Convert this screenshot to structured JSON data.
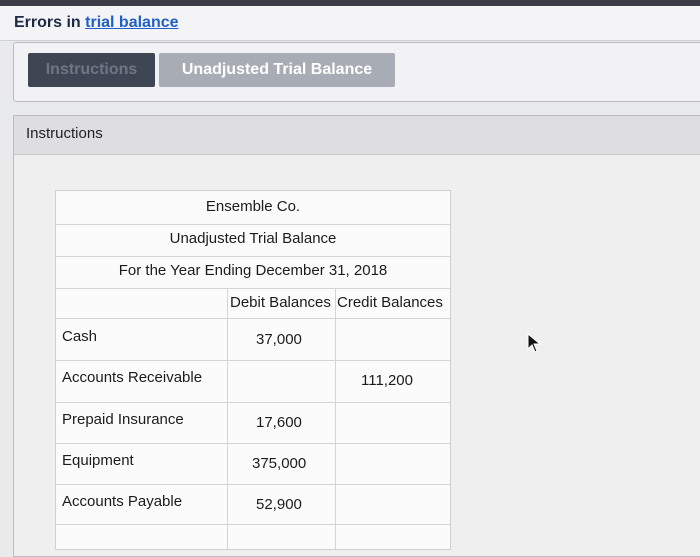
{
  "page": {
    "title_prefix": "Errors in ",
    "title_link": "trial balance"
  },
  "tabs": [
    {
      "label": "Instructions"
    },
    {
      "label": "Unadjusted Trial Balance"
    }
  ],
  "content": {
    "header_label": "Instructions"
  },
  "trial_balance": {
    "company": "Ensemble Co.",
    "report_title": "Unadjusted Trial Balance",
    "period": "For the Year Ending December 31, 2018",
    "col_debit": "Debit Balances",
    "col_credit": "Credit Balances",
    "rows": [
      {
        "account": "Cash",
        "debit": "37,000",
        "credit": ""
      },
      {
        "account": "Accounts Receivable",
        "debit": "",
        "credit": "111,200"
      },
      {
        "account": "Prepaid Insurance",
        "debit": "17,600",
        "credit": ""
      },
      {
        "account": "Equipment",
        "debit": "375,000",
        "credit": ""
      },
      {
        "account": "Accounts Payable",
        "debit": "52,900",
        "credit": ""
      }
    ]
  },
  "icons": {
    "cursor": "mouse-pointer-icon"
  }
}
